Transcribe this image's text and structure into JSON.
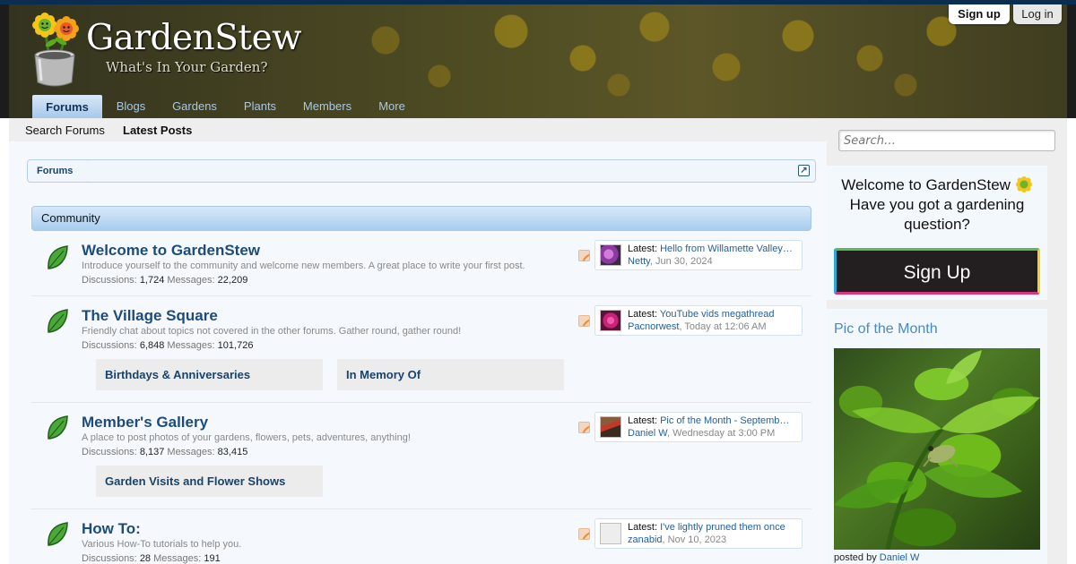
{
  "header": {
    "site_name": "GardenStew",
    "tagline": "What's In Your Garden?",
    "signup_label": "Sign up",
    "login_label": "Log in"
  },
  "nav": {
    "tabs": [
      {
        "label": "Forums",
        "active": true
      },
      {
        "label": "Blogs"
      },
      {
        "label": "Gardens"
      },
      {
        "label": "Plants"
      },
      {
        "label": "Members"
      },
      {
        "label": "More"
      }
    ]
  },
  "subnav": {
    "search_forums": "Search Forums",
    "latest_posts": "Latest Posts"
  },
  "breadcrumb": {
    "item": "Forums"
  },
  "category": {
    "title": "Community"
  },
  "forums": [
    {
      "title": "Welcome to GardenStew",
      "description": "Introduce yourself to the community and welcome new members. A great place to write your first post.",
      "discussions_label": "Discussions:",
      "discussions": "1,724",
      "messages_label": "Messages:",
      "messages": "22,209",
      "latest_label": "Latest:",
      "latest_thread": "Hello from Willamette Valley…",
      "latest_user": "Netty",
      "latest_date": "Jun 30, 2024",
      "subforums": []
    },
    {
      "title": "The Village Square",
      "description": "Friendly chat about topics not covered in the other forums. Gather round, gather round!",
      "discussions_label": "Discussions:",
      "discussions": "6,848",
      "messages_label": "Messages:",
      "messages": "101,726",
      "latest_label": "Latest:",
      "latest_thread": "YouTube vids megathread",
      "latest_user": "Pacnorwest",
      "latest_date": "Today at 12:06 AM",
      "subforums": [
        "Birthdays & Anniversaries",
        "In Memory Of"
      ]
    },
    {
      "title": "Member's Gallery",
      "description": "A place to post photos of your gardens, flowers, pets, adventures, anything!",
      "discussions_label": "Discussions:",
      "discussions": "8,137",
      "messages_label": "Messages:",
      "messages": "83,415",
      "latest_label": "Latest:",
      "latest_thread": "Pic of the Month - Septemb…",
      "latest_user": "Daniel W",
      "latest_date": "Wednesday at 3:00 PM",
      "subforums": [
        "Garden Visits and Flower Shows"
      ]
    },
    {
      "title": "How To:",
      "description": "Various How-To tutorials to help you.",
      "discussions_label": "Discussions:",
      "discussions": "28",
      "messages_label": "Messages:",
      "messages": "191",
      "latest_label": "Latest:",
      "latest_thread": "I've lightly pruned them once",
      "latest_user": "zanabid",
      "latest_date": "Nov 10, 2023",
      "subforums": []
    }
  ],
  "sidebar": {
    "search_placeholder": "Search…",
    "welcome_line1": "Welcome to GardenStew",
    "welcome_line2": "Have you got a gardening question?",
    "signup_button": "Sign Up",
    "potm_title": "Pic of the Month",
    "potm_caption_prefix": "posted by",
    "potm_caption_user": "Daniel W"
  },
  "colors": {
    "forum_title": "#1d4c7c",
    "link": "#2360a0",
    "category_bar": "#a8cdef",
    "signup_button_bg": "#231f20"
  }
}
